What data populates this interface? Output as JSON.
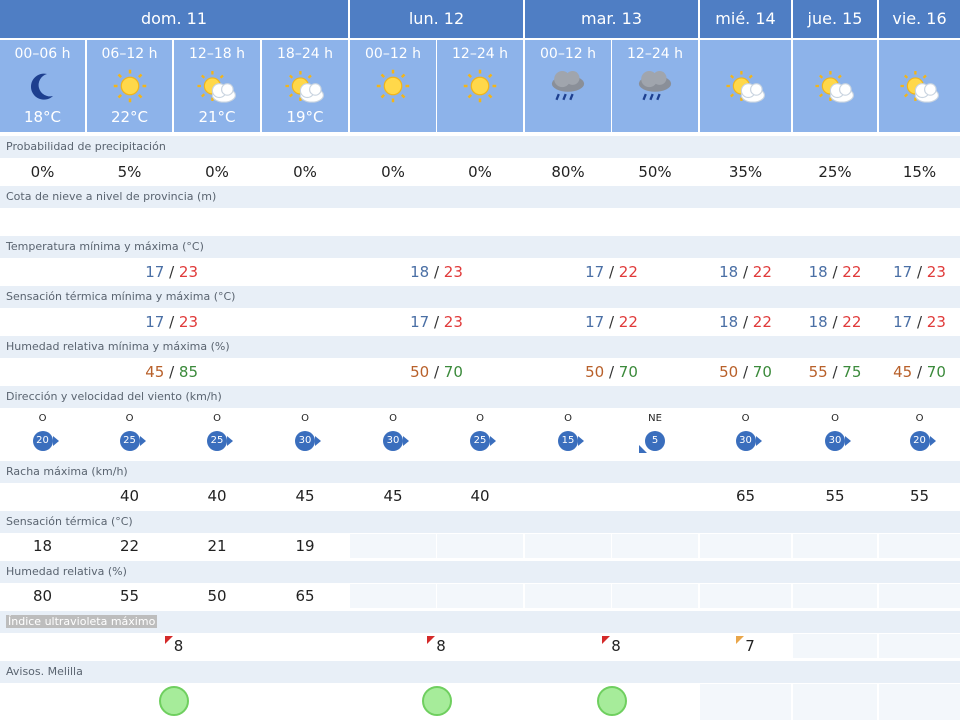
{
  "days": [
    {
      "label": "dom. 11"
    },
    {
      "label": "lun. 12"
    },
    {
      "label": "mar. 13"
    },
    {
      "label": "mié. 14"
    },
    {
      "label": "jue. 15"
    },
    {
      "label": "vie. 16"
    }
  ],
  "periods": [
    {
      "label": "00–06 h",
      "icon": "moon-icon",
      "temp": "18°C"
    },
    {
      "label": "06–12 h",
      "icon": "sun-icon",
      "temp": "22°C"
    },
    {
      "label": "12–18 h",
      "icon": "sun-cloud-icon",
      "temp": "21°C"
    },
    {
      "label": "18–24 h",
      "icon": "sun-cloud-icon",
      "temp": "19°C"
    },
    {
      "label": "00–12 h",
      "icon": "sun-icon",
      "temp": ""
    },
    {
      "label": "12–24 h",
      "icon": "sun-icon",
      "temp": ""
    },
    {
      "label": "00–12 h",
      "icon": "rain-cloud-icon",
      "temp": ""
    },
    {
      "label": "12–24 h",
      "icon": "rain-cloud-icon",
      "temp": ""
    },
    {
      "label": "",
      "icon": "sun-cloud-icon",
      "temp": ""
    },
    {
      "label": "",
      "icon": "sun-cloud-icon",
      "temp": ""
    },
    {
      "label": "",
      "icon": "sun-cloud-icon",
      "temp": ""
    }
  ],
  "sections": {
    "precip": "Probabilidad de precipitación",
    "snow": "Cota de nieve a nivel de provincia (m)",
    "temp": "Temperatura mínima y máxima (°C)",
    "feels": "Sensación térmica mínima y máxima (°C)",
    "humidity": "Humedad relativa mínima y máxima (%)",
    "wind": "Dirección y velocidad del viento (km/h)",
    "gust": "Racha máxima (km/h)",
    "feels_hourly": "Sensación térmica (°C)",
    "humidity_hourly": "Humedad relativa (%)",
    "uv": "Índice ultravioleta máximo",
    "warnings": "Avisos. Melilla"
  },
  "precip": [
    "0%",
    "5%",
    "0%",
    "0%",
    "0%",
    "0%",
    "80%",
    "50%",
    "35%",
    "25%",
    "15%"
  ],
  "temp": [
    {
      "min": "17",
      "max": "23"
    },
    {
      "min": "18",
      "max": "23"
    },
    {
      "min": "17",
      "max": "22"
    },
    {
      "min": "18",
      "max": "22"
    },
    {
      "min": "18",
      "max": "22"
    },
    {
      "min": "17",
      "max": "23"
    }
  ],
  "feels": [
    {
      "min": "17",
      "max": "23"
    },
    {
      "min": "17",
      "max": "23"
    },
    {
      "min": "17",
      "max": "22"
    },
    {
      "min": "18",
      "max": "22"
    },
    {
      "min": "18",
      "max": "22"
    },
    {
      "min": "17",
      "max": "23"
    }
  ],
  "humidity": [
    {
      "min": "45",
      "max": "85"
    },
    {
      "min": "50",
      "max": "70"
    },
    {
      "min": "50",
      "max": "70"
    },
    {
      "min": "50",
      "max": "70"
    },
    {
      "min": "55",
      "max": "75"
    },
    {
      "min": "45",
      "max": "70"
    }
  ],
  "wind": [
    {
      "dir": "O",
      "speed": "20"
    },
    {
      "dir": "O",
      "speed": "25"
    },
    {
      "dir": "O",
      "speed": "25"
    },
    {
      "dir": "O",
      "speed": "30"
    },
    {
      "dir": "O",
      "speed": "30"
    },
    {
      "dir": "O",
      "speed": "25"
    },
    {
      "dir": "O",
      "speed": "15"
    },
    {
      "dir": "NE",
      "speed": "5"
    },
    {
      "dir": "O",
      "speed": "30"
    },
    {
      "dir": "O",
      "speed": "30"
    },
    {
      "dir": "O",
      "speed": "20"
    }
  ],
  "gust": [
    "",
    "40",
    "40",
    "45",
    "45",
    "40",
    "",
    "",
    "65",
    "55",
    "55"
  ],
  "feels_hourly": [
    "18",
    "22",
    "21",
    "19"
  ],
  "humidity_hourly": [
    "80",
    "55",
    "50",
    "65"
  ],
  "uv": [
    {
      "value": "8",
      "level_color": "#d42a2a"
    },
    {
      "value": "8",
      "level_color": "#d42a2a"
    },
    {
      "value": "8",
      "level_color": "#d42a2a"
    },
    {
      "value": "7",
      "level_color": "#e9a64a"
    }
  ],
  "warnings": [
    {
      "status": "green-light-icon",
      "color": "#a6ec9a"
    },
    {
      "status": "green-light-icon",
      "color": "#a6ec9a"
    },
    {
      "status": "green-light-icon",
      "color": "#a6ec9a"
    }
  ]
}
